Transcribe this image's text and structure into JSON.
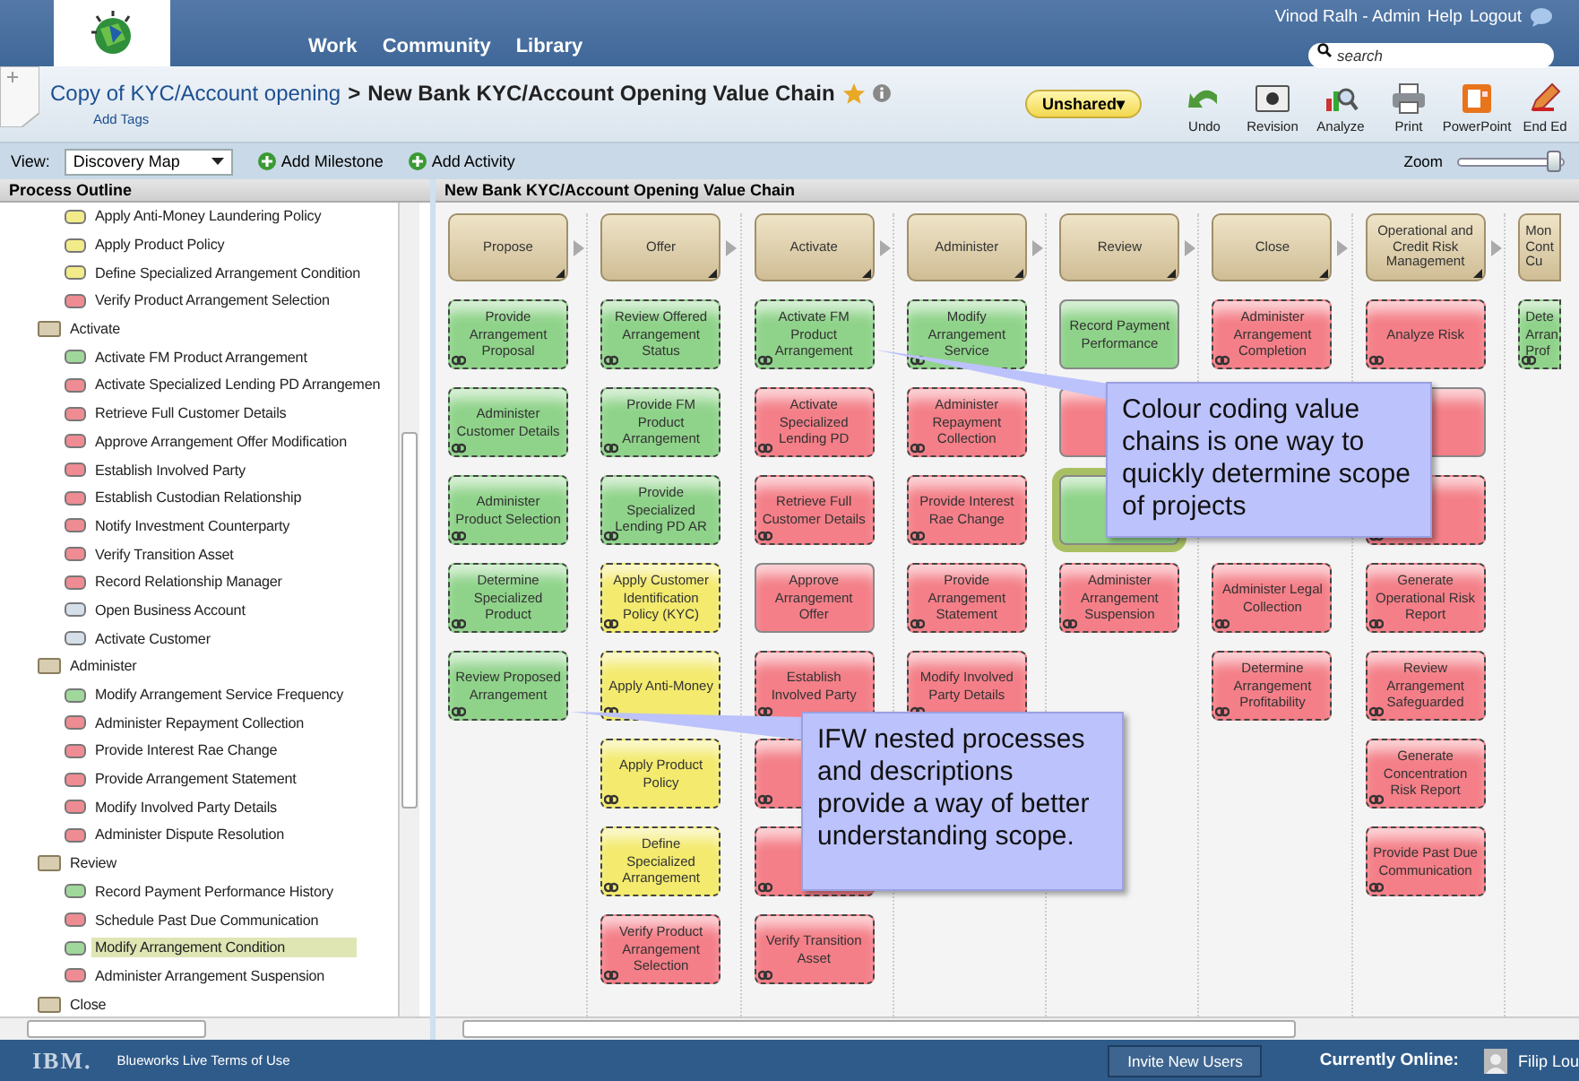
{
  "header": {
    "nav": [
      "Work",
      "Community",
      "Library"
    ],
    "user": "Vinod Ralh - Admin",
    "links": [
      "Help",
      "Logout"
    ],
    "search": {
      "placeholder": "search"
    }
  },
  "title_bar": {
    "breadcrumb": "Copy of KYC/Account opening",
    "separator": ">",
    "title": "New Bank KYC/Account Opening Value Chain",
    "add_tags": "Add Tags",
    "share": "Unshared▾",
    "tools": [
      {
        "kind": "undo",
        "label": "Undo"
      },
      {
        "kind": "history",
        "label": "Revision"
      },
      {
        "kind": "analyze",
        "label": "Analyze"
      },
      {
        "kind": "print",
        "label": "Print"
      },
      {
        "kind": "powerpoint",
        "label": "PowerPoint"
      },
      {
        "kind": "edit",
        "label": "End Ed"
      }
    ]
  },
  "view_bar": {
    "view_label": "View:",
    "view": "Discovery Map",
    "actions": [
      "Add Milestone",
      "Add Activity"
    ],
    "zoom_label": "Zoom",
    "zoom": {
      "level": 0.95
    }
  },
  "outline": {
    "title": "Process Outline",
    "items": [
      {
        "children": [
          {
            "label": "Apply Anti-Money Laundering Policy",
            "color": "#f2eb8a",
            "selected": false
          },
          {
            "label": "Apply Product Policy",
            "color": "#f2eb8a",
            "selected": false
          },
          {
            "label": "Define Specialized Arrangement Condition",
            "color": "#f2eb8a",
            "selected": false
          },
          {
            "label": "Verify Product Arrangement Selection",
            "color": "#ef8b92",
            "selected": false
          }
        ]
      },
      {
        "label": "Activate",
        "children": [
          {
            "label": "Activate FM Product Arrangement",
            "color": "#9fd89a",
            "selected": false
          },
          {
            "label": "Activate Specialized Lending PD Arrangemen",
            "color": "#ef8b92",
            "selected": false
          },
          {
            "label": "Retrieve Full Customer Details",
            "color": "#ef8b92",
            "selected": false
          },
          {
            "label": "Approve Arrangement Offer Modification",
            "color": "#ef8b92",
            "selected": false
          },
          {
            "label": "Establish Involved Party",
            "color": "#ef8b92",
            "selected": false
          },
          {
            "label": "Establish Custodian Relationship",
            "color": "#ef8b92",
            "selected": false
          },
          {
            "label": "Notify Investment Counterparty",
            "color": "#ef8b92",
            "selected": false
          },
          {
            "label": "Verify Transition Asset",
            "color": "#ef8b92",
            "selected": false
          },
          {
            "label": "Record Relationship Manager",
            "color": "#ef8b92",
            "selected": false
          },
          {
            "label": "Open Business Account",
            "color": "#d5dfea",
            "selected": false
          },
          {
            "label": "Activate Customer",
            "color": "#d5dfea",
            "selected": false
          }
        ]
      },
      {
        "label": "Administer",
        "children": [
          {
            "label": "Modify Arrangement Service Frequency",
            "color": "#9fd89a",
            "selected": false
          },
          {
            "label": "Administer Repayment Collection",
            "color": "#ef8b92",
            "selected": false
          },
          {
            "label": "Provide Interest Rae Change",
            "color": "#ef8b92",
            "selected": false
          },
          {
            "label": "Provide Arrangement Statement",
            "color": "#ef8b92",
            "selected": false
          },
          {
            "label": "Modify Involved Party Details",
            "color": "#ef8b92",
            "selected": false
          },
          {
            "label": "Administer Dispute Resolution",
            "color": "#ef8b92",
            "selected": false
          }
        ]
      },
      {
        "label": "Review",
        "children": [
          {
            "label": "Record Payment Performance History",
            "color": "#9fd89a",
            "selected": false
          },
          {
            "label": "Schedule Past Due Communication",
            "color": "#ef8b92",
            "selected": false
          },
          {
            "label": "Modify Arrangement Condition",
            "color": "#9fd89a",
            "selected": true
          },
          {
            "label": "Administer Arrangement Suspension",
            "color": "#ef8b92",
            "selected": false
          }
        ]
      },
      {
        "label": "Close"
      }
    ]
  },
  "canvas": {
    "title": "New Bank KYC/Account Opening Value Chain",
    "columns": [
      {
        "title": "Propose",
        "cut": false,
        "cards": [
          {
            "text": "Provide Arrangement Proposal",
            "color": "#8fd38a",
            "nested": true,
            "selected": false
          },
          {
            "text": "Administer Customer Details",
            "color": "#8fd38a",
            "nested": true,
            "selected": false
          },
          {
            "text": "Administer Product Selection",
            "color": "#8fd38a",
            "nested": true,
            "selected": false
          },
          {
            "text": "Determine Specialized Product",
            "color": "#8fd38a",
            "nested": true,
            "selected": false
          },
          {
            "text": "Review Proposed Arrangement",
            "color": "#8fd38a",
            "nested": true,
            "selected": false
          }
        ]
      },
      {
        "title": "Offer",
        "cut": false,
        "cards": [
          {
            "text": "Review Offered Arrangement Status",
            "color": "#8fd38a",
            "nested": true,
            "selected": false
          },
          {
            "text": "Provide FM Product Arrangement",
            "color": "#8fd38a",
            "nested": true,
            "selected": false
          },
          {
            "text": "Provide Specialized Lending PD AR",
            "color": "#8fd38a",
            "nested": true,
            "selected": false
          },
          {
            "text": "Apply Customer Identification Policy (KYC)",
            "color": "#f3ea6e",
            "nested": true,
            "selected": false
          },
          {
            "text": "Apply Anti-Money",
            "color": "#f3ea6e",
            "nested": true,
            "selected": false
          },
          {
            "text": "Apply Product Policy",
            "color": "#f3ea6e",
            "nested": true,
            "selected": false
          },
          {
            "text": "Define Specialized Arrangement",
            "color": "#f3ea6e",
            "nested": true,
            "selected": false
          },
          {
            "text": "Verify Product Arrangement Selection",
            "color": "#f47f88",
            "nested": true,
            "selected": false
          }
        ]
      },
      {
        "title": "Activate",
        "cut": false,
        "cards": [
          {
            "text": "Activate FM Product Arrangement",
            "color": "#8fd38a",
            "nested": true,
            "selected": false
          },
          {
            "text": "Activate Specialized Lending PD",
            "color": "#f47f88",
            "nested": true,
            "selected": false
          },
          {
            "text": "Retrieve Full Customer Details",
            "color": "#f47f88",
            "nested": true,
            "selected": false
          },
          {
            "text": "Approve Arrangement Offer",
            "color": "#f47f88",
            "nested": false,
            "selected": false
          },
          {
            "text": "Establish Involved Party",
            "color": "#f47f88",
            "nested": true,
            "selected": false
          },
          {
            "color": "#f47f88",
            "nested": true,
            "selected": false
          },
          {
            "color": "#f47f88",
            "nested": true,
            "selected": false
          },
          {
            "text": "Verify Transition Asset",
            "color": "#f47f88",
            "nested": true,
            "selected": false
          }
        ]
      },
      {
        "title": "Administer",
        "cut": false,
        "cards": [
          {
            "text": "Modify Arrangement Service",
            "color": "#8fd38a",
            "nested": true,
            "selected": false
          },
          {
            "text": "Administer Repayment Collection",
            "color": "#f47f88",
            "nested": true,
            "selected": false
          },
          {
            "text": "Provide Interest Rae Change",
            "color": "#f47f88",
            "nested": true,
            "selected": false
          },
          {
            "text": "Provide Arrangement Statement",
            "color": "#f47f88",
            "nested": true,
            "selected": false
          },
          {
            "text": "Modify Involved Party Details",
            "color": "#f47f88",
            "nested": true,
            "selected": false
          }
        ]
      },
      {
        "title": "Review",
        "cut": false,
        "cards": [
          {
            "text": "Record Payment Performance",
            "color": "#8fd38a",
            "nested": false,
            "selected": false
          },
          {
            "color": "#f47f88",
            "nested": false,
            "selected": false
          },
          {
            "color": "#8fd38a",
            "nested": false,
            "selected": true
          },
          {
            "text": "Administer Arrangement Suspension",
            "color": "#f47f88",
            "nested": true,
            "selected": false
          }
        ]
      },
      {
        "title": "Close",
        "cut": false,
        "cards": [
          {
            "text": "Administer Arrangement Completion",
            "color": "#f47f88",
            "nested": true,
            "selected": false
          },
          {
            "text": "Administer Legal Collection",
            "color": "#f47f88",
            "nested": true,
            "selected": false
          },
          {
            "text": "Determine Arrangement Profitability",
            "color": "#f47f88",
            "nested": true,
            "selected": false
          }
        ]
      },
      {
        "title": "Operational and Credit Risk Management",
        "cut": false,
        "cards": [
          {
            "text": "Analyze Risk",
            "color": "#f47f88",
            "nested": true,
            "selected": false
          },
          {
            "color": "#f47f88",
            "nested": false,
            "selected": false
          },
          {
            "color": "#f47f88",
            "nested": true,
            "selected": false
          },
          {
            "text": "Generate Operational Risk Report",
            "color": "#f47f88",
            "nested": true,
            "selected": false
          },
          {
            "text": "Review Arrangement Safeguarded",
            "color": "#f47f88",
            "nested": true,
            "selected": false
          },
          {
            "text": "Generate Concentration Risk Report",
            "color": "#f47f88",
            "nested": true,
            "selected": false
          },
          {
            "text": "Provide Past Due Communication",
            "color": "#f47f88",
            "nested": true,
            "selected": false
          }
        ]
      },
      {
        "title": "Mon Cont Cu",
        "cut": true,
        "cards": [
          {
            "text": "Dete Arran Prof",
            "color": "#8fd38a",
            "nested": true,
            "selected": false
          }
        ]
      }
    ],
    "callouts": [
      "Colour coding value chains is one way to quickly determine scope of projects",
      "IFW nested processes and descriptions provide a way of better understanding scope."
    ]
  },
  "footer": {
    "logo": "IBM.",
    "terms": "Blueworks Live Terms of Use",
    "invite": "Invite New Users",
    "online_label": "Currently Online:",
    "online_user": "Filip Lou"
  }
}
